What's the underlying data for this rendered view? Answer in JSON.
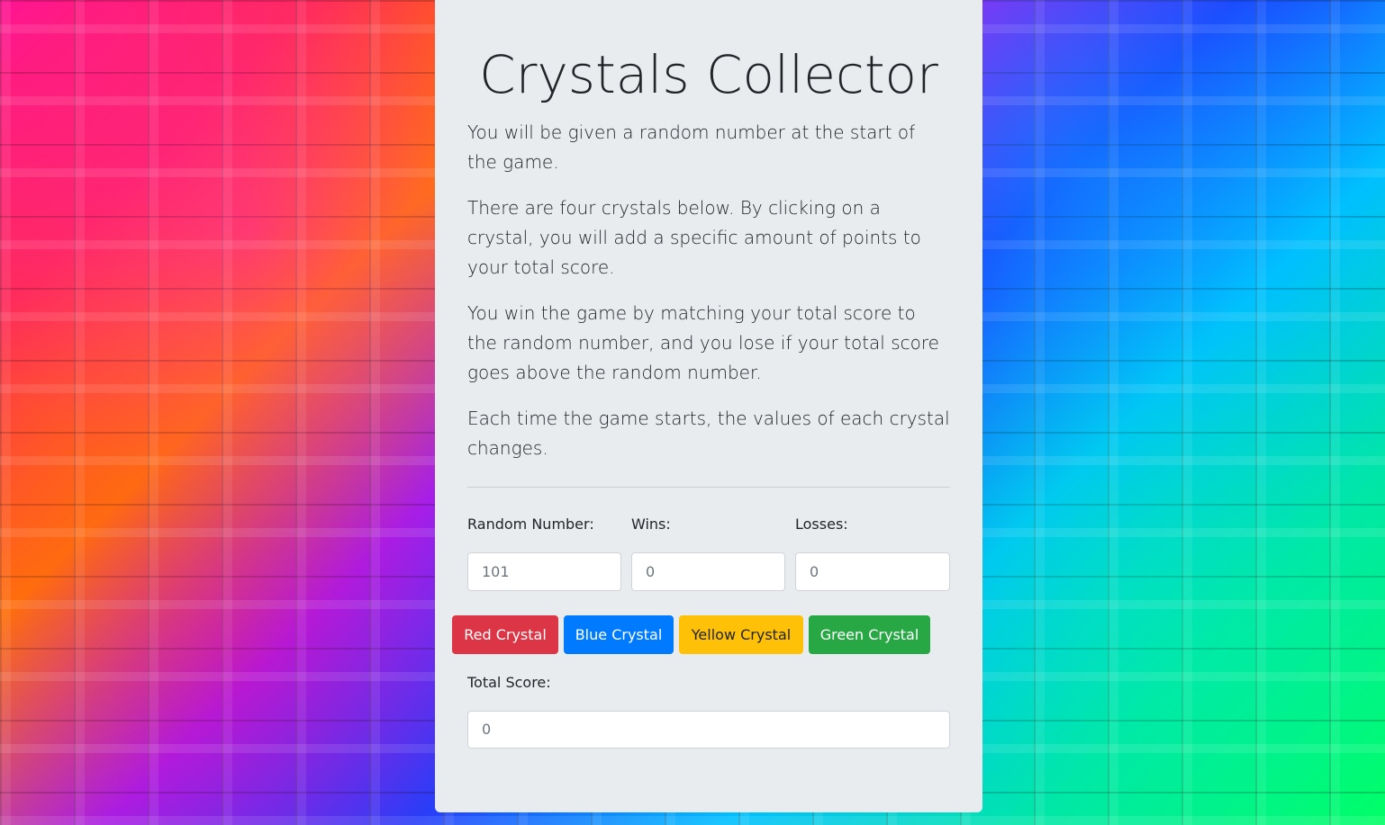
{
  "page": {
    "title": "Crystals Collector",
    "instructions": [
      "You will be given a random number at the start of the game.",
      "There are four crystals below. By clicking on a crystal, you will add a specific amount of points to your total score.",
      "You win the game by matching your total score to the random number, and you lose if your total score goes above the random number.",
      "Each time the game starts, the values of each crystal changes."
    ]
  },
  "stats": {
    "random_number_label": "Random Number:",
    "random_number_value": "101",
    "wins_label": "Wins:",
    "wins_value": "0",
    "losses_label": "Losses:",
    "losses_value": "0"
  },
  "crystals": {
    "red_label": "Red Crystal",
    "blue_label": "Blue Crystal",
    "yellow_label": "Yellow Crystal",
    "green_label": "Green Crystal",
    "colors": {
      "red": "#dc3545",
      "blue": "#007bff",
      "yellow": "#ffc107",
      "green": "#28a745"
    }
  },
  "score": {
    "total_label": "Total Score:",
    "total_value": "0"
  },
  "theme": {
    "panel_background": "#e9ecef",
    "background": "rainbow-cubes-pattern"
  }
}
